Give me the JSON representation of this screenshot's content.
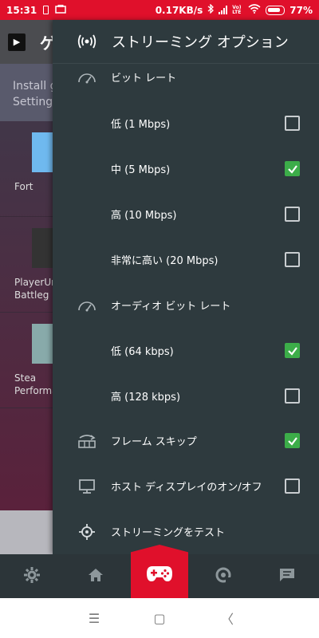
{
  "status_bar": {
    "time": "15:31",
    "network_speed": "0.17KB/s",
    "network_label": "Vo) LTE",
    "battery": "77%",
    "color": "#e0102b"
  },
  "background_app": {
    "title": "ゲ",
    "install_text_1": "Install g",
    "install_text_2": "Settings",
    "cards": [
      {
        "label_1": "Fort",
        "label_2": ""
      },
      {
        "label_1": "PlayerUn",
        "label_2": "Battleg"
      },
      {
        "label_1": "Stea",
        "label_2": "Performa"
      }
    ]
  },
  "drawer": {
    "title": "ストリーミング オプション",
    "header_icon": "streaming-signal-icon",
    "items": [
      {
        "label": "ビット レート",
        "icon": "speedometer-icon",
        "type": "section"
      },
      {
        "label": "低 (1 Mbps)",
        "checked": false
      },
      {
        "label": "中 (5 Mbps)",
        "checked": true
      },
      {
        "label": "高 (10 Mbps)",
        "checked": false
      },
      {
        "label": "非常に高い (20 Mbps)",
        "checked": false
      },
      {
        "label": "オーディオ ビット レート",
        "icon": "speedometer-icon",
        "type": "section"
      },
      {
        "label": "低 (64 kbps)",
        "checked": true
      },
      {
        "label": "高 (128 kbps)",
        "checked": false
      },
      {
        "label": "フレーム スキップ",
        "icon": "frame-skip-icon",
        "checked": true
      },
      {
        "label": "ホスト ディスプレイのオン/オフ",
        "icon": "monitor-icon",
        "checked": false
      },
      {
        "label": "ストリーミングをテスト",
        "icon": "crosshair-icon",
        "type": "action"
      }
    ],
    "check_color": "#3cad49"
  },
  "bottom_nav": {
    "items": [
      {
        "name": "settings",
        "icon": "gear-icon"
      },
      {
        "name": "home",
        "icon": "home-icon"
      },
      {
        "name": "games",
        "icon": "gamepad-icon",
        "active": true
      },
      {
        "name": "stream",
        "icon": "swirl-icon"
      },
      {
        "name": "messages",
        "icon": "chat-icon"
      }
    ]
  },
  "system_nav": {
    "items": [
      {
        "icon": "menu-icon",
        "glyph": "☰"
      },
      {
        "icon": "home-square-icon",
        "glyph": "▢"
      },
      {
        "icon": "back-icon",
        "glyph": "〈"
      }
    ]
  }
}
